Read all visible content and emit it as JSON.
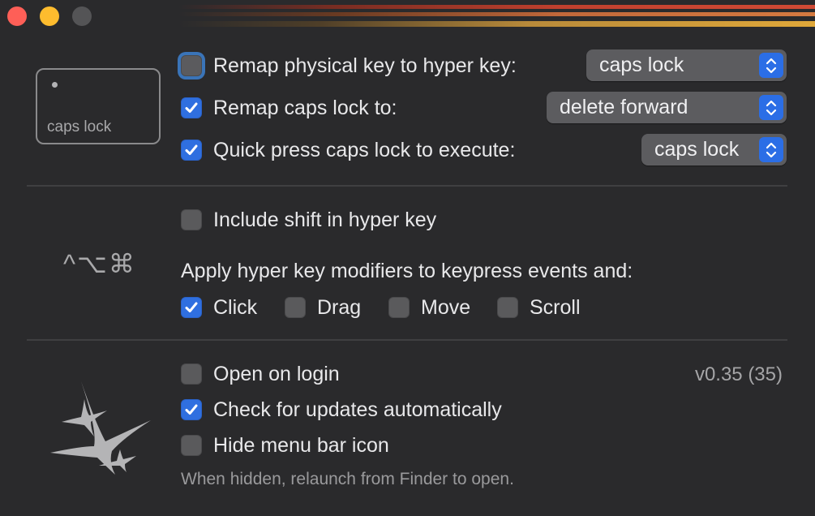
{
  "window": {
    "traffic_lights": [
      "close",
      "minimize",
      "zoom"
    ]
  },
  "hyper_section": {
    "key_preview_label": "caps lock",
    "rows": [
      {
        "label": "Remap physical key to hyper key:",
        "checked": false,
        "focused": true,
        "select_value": "caps lock"
      },
      {
        "label": "Remap caps lock to:",
        "checked": true,
        "focused": false,
        "select_value": "delete forward"
      },
      {
        "label": "Quick press caps lock to execute:",
        "checked": true,
        "focused": false,
        "select_value": "caps lock"
      }
    ]
  },
  "modifiers_section": {
    "modifier_symbols": "^⌥⌘",
    "include_shift": {
      "label": "Include shift in hyper key",
      "checked": false
    },
    "apply_heading": "Apply hyper key modifiers to keypress events and:",
    "events": [
      {
        "label": "Click",
        "checked": true
      },
      {
        "label": "Drag",
        "checked": false
      },
      {
        "label": "Move",
        "checked": false
      },
      {
        "label": "Scroll",
        "checked": false
      }
    ]
  },
  "general_section": {
    "version": "v0.35 (35)",
    "options": [
      {
        "label": "Open on login",
        "checked": false
      },
      {
        "label": "Check for updates automatically",
        "checked": true
      },
      {
        "label": "Hide menu bar icon",
        "checked": false
      }
    ],
    "hint": "When hidden, relaunch from Finder to open."
  },
  "colors": {
    "accent": "#2f6fe0",
    "background": "#2a2a2c",
    "close": "#fe5f57",
    "minimize": "#febc2e"
  }
}
